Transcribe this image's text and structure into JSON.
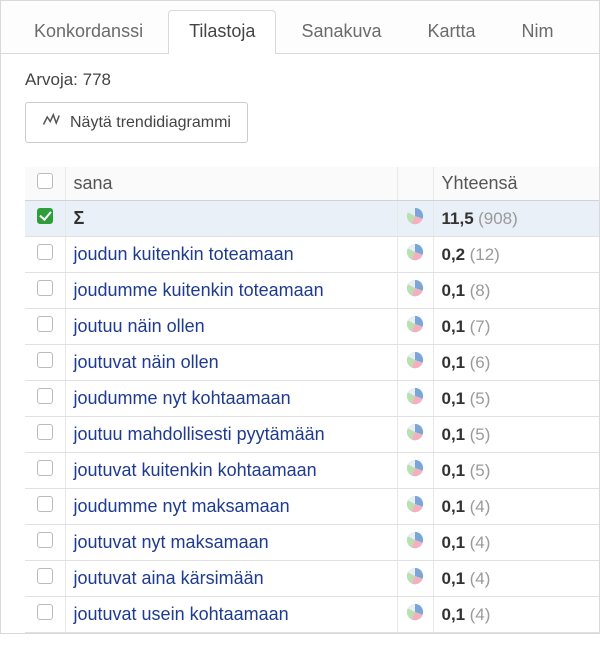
{
  "tabs": [
    {
      "label": "Konkordanssi",
      "active": false
    },
    {
      "label": "Tilastoja",
      "active": true
    },
    {
      "label": "Sanakuva",
      "active": false
    },
    {
      "label": "Kartta",
      "active": false
    },
    {
      "label": "Nim",
      "active": false
    }
  ],
  "count_label": "Arvoja: 778",
  "trend_button": "Näytä trendidiagrammi",
  "columns": {
    "word": "sana",
    "total": "Yhteensä"
  },
  "rows": [
    {
      "checked": true,
      "label": "Σ",
      "sigma": true,
      "value": "11,5",
      "count": "(908)"
    },
    {
      "checked": false,
      "label": "joudun kuitenkin toteamaan",
      "value": "0,2",
      "count": "(12)"
    },
    {
      "checked": false,
      "label": "joudumme kuitenkin toteamaan",
      "value": "0,1",
      "count": "(8)"
    },
    {
      "checked": false,
      "label": "joutuu näin ollen",
      "value": "0,1",
      "count": "(7)"
    },
    {
      "checked": false,
      "label": "joutuvat näin ollen",
      "value": "0,1",
      "count": "(6)"
    },
    {
      "checked": false,
      "label": "joudumme nyt kohtaamaan",
      "value": "0,1",
      "count": "(5)"
    },
    {
      "checked": false,
      "label": "joutuu mahdollisesti pyytämään",
      "value": "0,1",
      "count": "(5)"
    },
    {
      "checked": false,
      "label": "joutuvat kuitenkin kohtaamaan",
      "value": "0,1",
      "count": "(5)"
    },
    {
      "checked": false,
      "label": "joudumme nyt maksamaan",
      "value": "0,1",
      "count": "(4)"
    },
    {
      "checked": false,
      "label": "joutuvat nyt maksamaan",
      "value": "0,1",
      "count": "(4)"
    },
    {
      "checked": false,
      "label": "joutuvat aina kärsimään",
      "value": "0,1",
      "count": "(4)"
    },
    {
      "checked": false,
      "label": "joutuvat usein kohtaamaan",
      "value": "0,1",
      "count": "(4)"
    }
  ]
}
